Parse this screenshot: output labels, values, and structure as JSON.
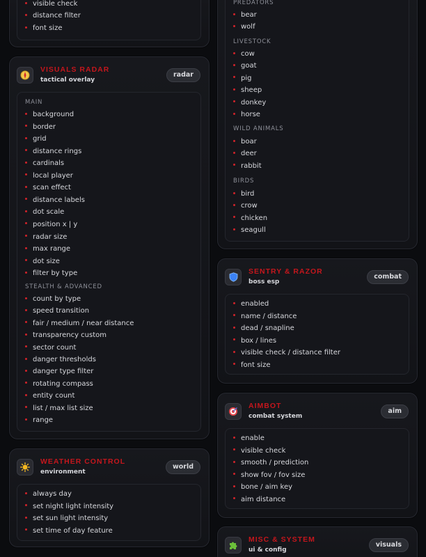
{
  "left": {
    "top_card": {
      "items": [
        "visible check",
        "distance filter",
        "font size"
      ]
    },
    "radar": {
      "title": "VISUALS RADAR",
      "subtitle": "tactical overlay",
      "pill": "radar",
      "icon": "compass-icon",
      "groups": [
        {
          "label": "MAIN",
          "items": [
            "background",
            "border",
            "grid",
            "distance rings",
            "cardinals",
            "local player",
            "scan effect",
            "distance labels",
            "dot scale",
            "position x | y",
            "radar size",
            "max range",
            "dot size",
            "filter by type"
          ]
        },
        {
          "label": "STEALTH & ADVANCED",
          "items": [
            "count by type",
            "speed transition",
            "fair / medium / near distance",
            "transparency custom",
            "sector count",
            "danger thresholds",
            "danger type filter",
            "rotating compass",
            "entity count",
            "list / max list size",
            "range"
          ]
        }
      ]
    },
    "weather": {
      "title": "WEATHER CONTROL",
      "subtitle": "environment",
      "pill": "world",
      "icon": "sun-icon",
      "items": [
        "always day",
        "set night light intensity",
        "set sun light intensity",
        "set time of day feature"
      ]
    }
  },
  "right": {
    "animals": {
      "groups": [
        {
          "label": "PREDATORS",
          "items": [
            "bear",
            "wolf"
          ]
        },
        {
          "label": "LIVESTOCK",
          "items": [
            "cow",
            "goat",
            "pig",
            "sheep",
            "donkey",
            "horse"
          ]
        },
        {
          "label": "WILD ANIMALS",
          "items": [
            "boar",
            "deer",
            "rabbit"
          ]
        },
        {
          "label": "BIRDS",
          "items": [
            "bird",
            "crow",
            "chicken",
            "seagull"
          ]
        }
      ]
    },
    "sentry": {
      "title": "SENTRY & RAZOR",
      "subtitle": "boss esp",
      "pill": "combat",
      "icon": "shield-icon",
      "items": [
        "enabled",
        "name / distance",
        "dead / snapline",
        "box / lines",
        "visible check / distance filter",
        "font size"
      ]
    },
    "aimbot": {
      "title": "AIMBOT",
      "subtitle": "combat system",
      "pill": "aim",
      "icon": "target-icon",
      "items": [
        "enable",
        "visible check",
        "smooth / prediction",
        "show fov / fov size",
        "bone / aim key",
        "aim distance"
      ]
    },
    "misc": {
      "title": "MISC & SYSTEM",
      "subtitle": "ui & config",
      "pill": "visuals",
      "icon": "puzzle-icon"
    }
  }
}
